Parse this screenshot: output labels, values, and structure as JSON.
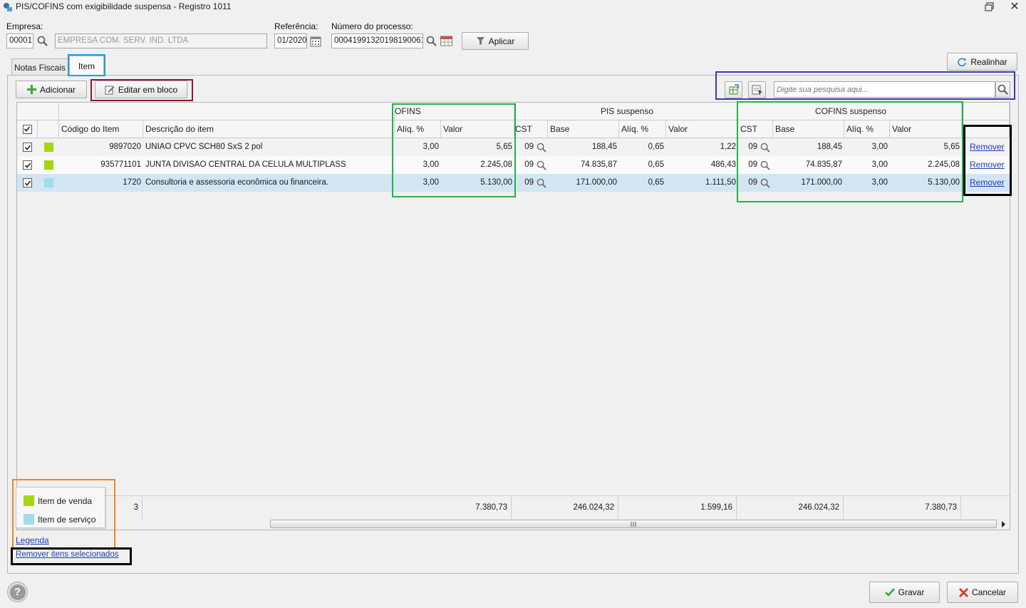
{
  "window": {
    "title": "PIS/COFINS com exigibilidade suspensa - Registro 1011",
    "close_glyph": "✕"
  },
  "filters": {
    "empresa_label": "Empresa:",
    "empresa_code": "00001",
    "empresa_name": "EMPRESA COM. SERV. IND. LTDA",
    "referencia_label": "Referência:",
    "referencia_value": "01/2020",
    "processo_label": "Número do processo:",
    "processo_value": "00041991320198190061",
    "aplicar_label": "Aplicar"
  },
  "realinhar_label": "Realinhar",
  "tabs": [
    {
      "label": "Notas Fiscais",
      "active": false
    },
    {
      "label": "Item",
      "active": true
    }
  ],
  "toolbar": {
    "adicionar_label": "Adicionar",
    "editar_bloco_label": "Editar em bloco",
    "search_placeholder": "Digite sua pesquisa aqui..."
  },
  "grid": {
    "group_headers": {
      "cofins_partial": "OFINS",
      "pis_suspenso": "PIS suspenso",
      "cofins_suspenso": "COFINS suspenso"
    },
    "columns": {
      "codigo": "Código do Item",
      "descricao": "Descrição do item",
      "aliq": "Alíq. %",
      "valor": "Valor",
      "cst": "CST",
      "base": "Base",
      "pis_aliq": "Alíq. %",
      "pis_valor": "Valor",
      "cofins_cst": "CST",
      "cofins_base": "Base",
      "cofins_aliq": "Alíq. %",
      "cofins_valor": "Valor"
    },
    "rows": [
      {
        "checked": true,
        "type": "venda",
        "codigo": "9897020",
        "descricao": "UNIAO CPVC SCH80 SxS 2 pol",
        "cofins_aliq": "3,00",
        "cofins_valor": "5,65",
        "pis_cst": "09",
        "pis_base": "188,45",
        "pis_aliq": "0,65",
        "pis_valor": "1,22",
        "cofs_cst": "09",
        "cofs_base": "188,45",
        "cofs_aliq": "3,00",
        "cofs_valor": "5,65",
        "action": "Remover"
      },
      {
        "checked": true,
        "type": "venda",
        "codigo": "935771101",
        "descricao": "JUNTA DIVISAO CENTRAL DA CELULA MULTIPLASS",
        "cofins_aliq": "3,00",
        "cofins_valor": "2.245,08",
        "pis_cst": "09",
        "pis_base": "74.835,87",
        "pis_aliq": "0,65",
        "pis_valor": "486,43",
        "cofs_cst": "09",
        "cofs_base": "74.835,87",
        "cofs_aliq": "3,00",
        "cofs_valor": "2.245,08",
        "action": "Remover"
      },
      {
        "checked": true,
        "type": "servico",
        "codigo": "1720",
        "descricao": "Consultoria e assessoria econômica ou financeira.",
        "cofins_aliq": "3,00",
        "cofins_valor": "5.130,00",
        "pis_cst": "09",
        "pis_base": "171.000,00",
        "pis_aliq": "0,65",
        "pis_valor": "1.111,50",
        "cofs_cst": "09",
        "cofs_base": "171.000,00",
        "cofs_aliq": "3,00",
        "cofs_valor": "5.130,00",
        "action": "Remover"
      }
    ],
    "totals": {
      "partial": "3",
      "cofins_valor": "7.380,73",
      "pis_base": "246.024,32",
      "pis_valor": "1.599,16",
      "cofs_base": "246.024,32",
      "cofs_valor": "7.380,73"
    }
  },
  "legend": {
    "venda_label": "Item de venda",
    "servico_label": "Item de serviço",
    "link_label": "Legenda",
    "remove_selected_label": "Remover itens selecionados"
  },
  "footer": {
    "gravar_label": "Gravar",
    "cancelar_label": "Cancelar"
  },
  "colors": {
    "venda": "#a5d610",
    "servico": "#9fdde8",
    "selected_row": "#d2e5f3",
    "frame_cyan": "#17a2e0",
    "frame_maroon": "#8b1a2b",
    "frame_blue": "#3a3ab8",
    "frame_green": "#22b14c",
    "frame_black": "#000000",
    "frame_orange": "#f58220"
  }
}
